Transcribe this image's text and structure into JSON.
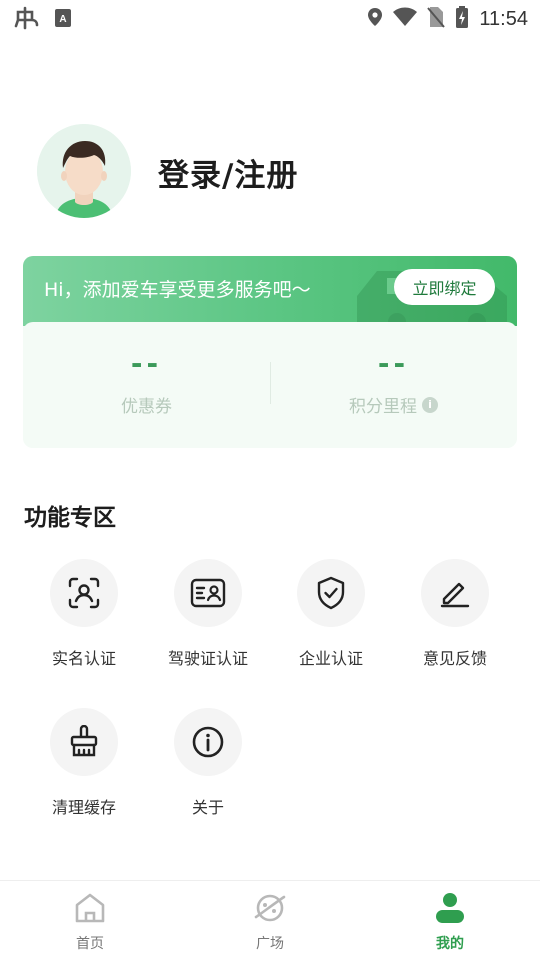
{
  "status_bar": {
    "time": "11:54",
    "icons": [
      "app-logo-icon",
      "text-a-icon",
      "location-icon",
      "wifi-icon",
      "no-sim-icon",
      "battery-charging-icon"
    ]
  },
  "profile": {
    "login_label": "登录/注册",
    "avatar_icon": "user-avatar"
  },
  "card": {
    "banner_text": "Hi，添加爱车享受更多服务吧～",
    "bind_button": "立即绑定",
    "stats": [
      {
        "value": "--",
        "label": "优惠券"
      },
      {
        "value": "--",
        "label": "积分里程",
        "icon": "info-icon"
      }
    ]
  },
  "features": {
    "title": "功能专区",
    "items": [
      {
        "label": "实名认证",
        "icon": "id-scan-icon"
      },
      {
        "label": "驾驶证认证",
        "icon": "license-card-icon"
      },
      {
        "label": "企业认证",
        "icon": "shield-check-icon"
      },
      {
        "label": "意见反馈",
        "icon": "edit-icon"
      },
      {
        "label": "清理缓存",
        "icon": "broom-icon"
      },
      {
        "label": "关于",
        "icon": "info-icon"
      }
    ]
  },
  "nav": {
    "items": [
      {
        "label": "首页",
        "icon": "home-icon",
        "active": false
      },
      {
        "label": "广场",
        "icon": "planet-icon",
        "active": false
      },
      {
        "label": "我的",
        "icon": "person-icon",
        "active": true
      }
    ],
    "active_color": "#2f9e4f"
  },
  "colors": {
    "accent": "#4cbf74",
    "stat_value": "#3b9a5a"
  }
}
